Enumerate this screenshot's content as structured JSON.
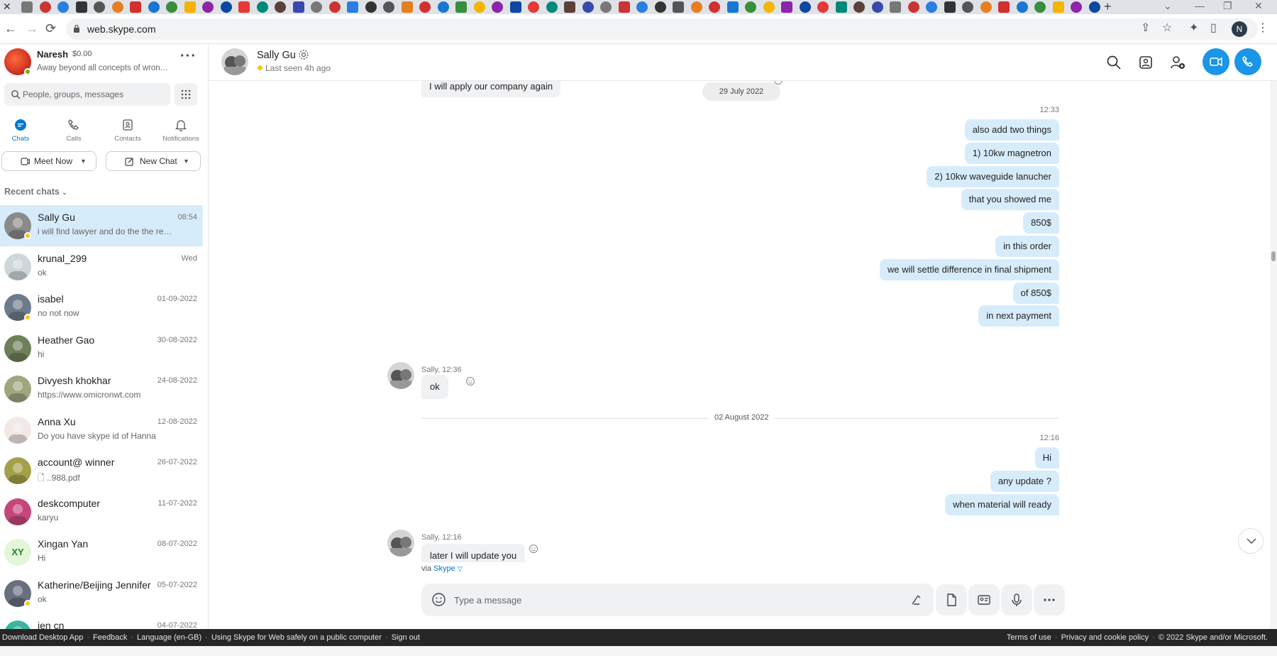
{
  "browser": {
    "url": "web.skype.com",
    "new_tab_label": "+",
    "profile_initial": "N"
  },
  "me": {
    "name": "Naresh",
    "balance": "$0.00",
    "mood": "Away beyond all concepts of wrong doing and right doing"
  },
  "search": {
    "placeholder": "People, groups, messages"
  },
  "nav": {
    "chats": "Chats",
    "calls": "Calls",
    "contacts": "Contacts",
    "notifications": "Notifications"
  },
  "actions": {
    "meet_now": "Meet Now",
    "new_chat": "New Chat"
  },
  "recent_label": "Recent chats",
  "chats": [
    {
      "name": "Sally Gu",
      "date": "08:54",
      "preview": "i will find lawyer and do the the registration",
      "avatar_color": "#8a8a8a",
      "status": true
    },
    {
      "name": "krunal_299",
      "date": "Wed",
      "preview": "ok",
      "avatar_color": "#cfd6da",
      "status": false
    },
    {
      "name": "isabel",
      "date": "01-09-2022",
      "preview": "no not now",
      "avatar_color": "#6d7b8a",
      "status": true
    },
    {
      "name": "Heather Gao",
      "date": "30-08-2022",
      "preview": "hi",
      "avatar_color": "#6f7f59",
      "status": false
    },
    {
      "name": "Divyesh khokhar",
      "date": "24-08-2022",
      "preview": "https://www.omicronwt.com",
      "avatar_color": "#9ea67f",
      "status": false
    },
    {
      "name": "Anna Xu",
      "date": "12-08-2022",
      "preview": "Do you have skype id of Hanna",
      "avatar_color": "#f2e8e6",
      "status": false
    },
    {
      "name": "account@ winner",
      "date": "26-07-2022",
      "preview": "..988.pdf",
      "avatar_color": "#a3a04a",
      "status": false
    },
    {
      "name": "deskcomputer",
      "date": "11-07-2022",
      "preview": "karyu",
      "avatar_color": "#c4477a",
      "status": false
    },
    {
      "name": "Xingan  Yan",
      "date": "08-07-2022",
      "preview": "Hi",
      "initials": "XY",
      "avatar_color": "#e4f6d8",
      "status": false
    },
    {
      "name": "Katherine/Beijing Jennifer",
      "date": "05-07-2022",
      "preview": "ok",
      "avatar_color": "#6a6f7e",
      "status": true
    },
    {
      "name": "jen cn",
      "date": "04-07-2022",
      "preview": "",
      "avatar_color": "#3bb5a0",
      "status": false
    }
  ],
  "conversation": {
    "name": "Sally Gu",
    "last_seen": "Last seen 4h ago",
    "date_pill": "29 July 2022",
    "time_1": "12:33",
    "first_in": "I will apply our company again",
    "out_messages_1": [
      "also add two things",
      "1) 10kw magnetron",
      "2) 10kw waveguide lanucher",
      "that you showed me",
      "850$",
      "in this order",
      "we will settle difference in final shipment",
      "of 850$",
      "in next payment"
    ],
    "sender_1": "Sally, 12:36",
    "in_1": "ok",
    "date_sep": "02 August 2022",
    "time_2": "12:16",
    "out_messages_2": [
      "Hi",
      "any update ?",
      "when material will ready"
    ],
    "sender_2": "Sally, 12:16",
    "in_2": "later I will update you",
    "via_prefix": "via",
    "via_link": "Skype"
  },
  "composer": {
    "placeholder": "Type a message"
  },
  "footer": {
    "left_links": [
      "Download Desktop App",
      "Feedback",
      "Language (en-GB)",
      "Using Skype for Web safely on a public computer",
      "Sign out"
    ],
    "right_links": [
      "Terms of use",
      "Privacy and cookie policy",
      "© 2022 Skype and/or Microsoft."
    ]
  },
  "colors": {
    "accent": "#0078d4",
    "call_button": "#1a95e7",
    "outgoing_bubble": "#d7ecfb",
    "incoming_bubble": "#f0f1f3",
    "away_status": "#fcc419",
    "online_status": "#6bb700",
    "footer_bg": "#262626"
  }
}
